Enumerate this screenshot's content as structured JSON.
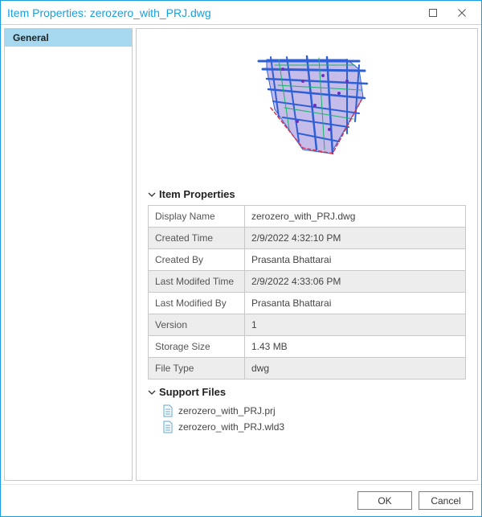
{
  "titlebar": {
    "title": "Item Properties: zerozero_with_PRJ.dwg"
  },
  "sidebar": {
    "items": [
      {
        "label": "General"
      }
    ]
  },
  "sections": {
    "item_properties": {
      "title": "Item Properties"
    },
    "support_files": {
      "title": "Support Files"
    }
  },
  "properties": [
    {
      "label": "Display Name",
      "value": "zerozero_with_PRJ.dwg"
    },
    {
      "label": "Created Time",
      "value": "2/9/2022 4:32:10 PM"
    },
    {
      "label": "Created By",
      "value": "Prasanta Bhattarai"
    },
    {
      "label": "Last Modifed Time",
      "value": "2/9/2022 4:33:06 PM"
    },
    {
      "label": "Last Modified By",
      "value": "Prasanta Bhattarai"
    },
    {
      "label": "Version",
      "value": "1"
    },
    {
      "label": "Storage Size",
      "value": "1.43 MB"
    },
    {
      "label": "File Type",
      "value": "dwg"
    }
  ],
  "support_files": [
    {
      "name": "zerozero_with_PRJ.prj"
    },
    {
      "name": "zerozero_with_PRJ.wld3"
    }
  ],
  "footer": {
    "ok": "OK",
    "cancel": "Cancel"
  }
}
